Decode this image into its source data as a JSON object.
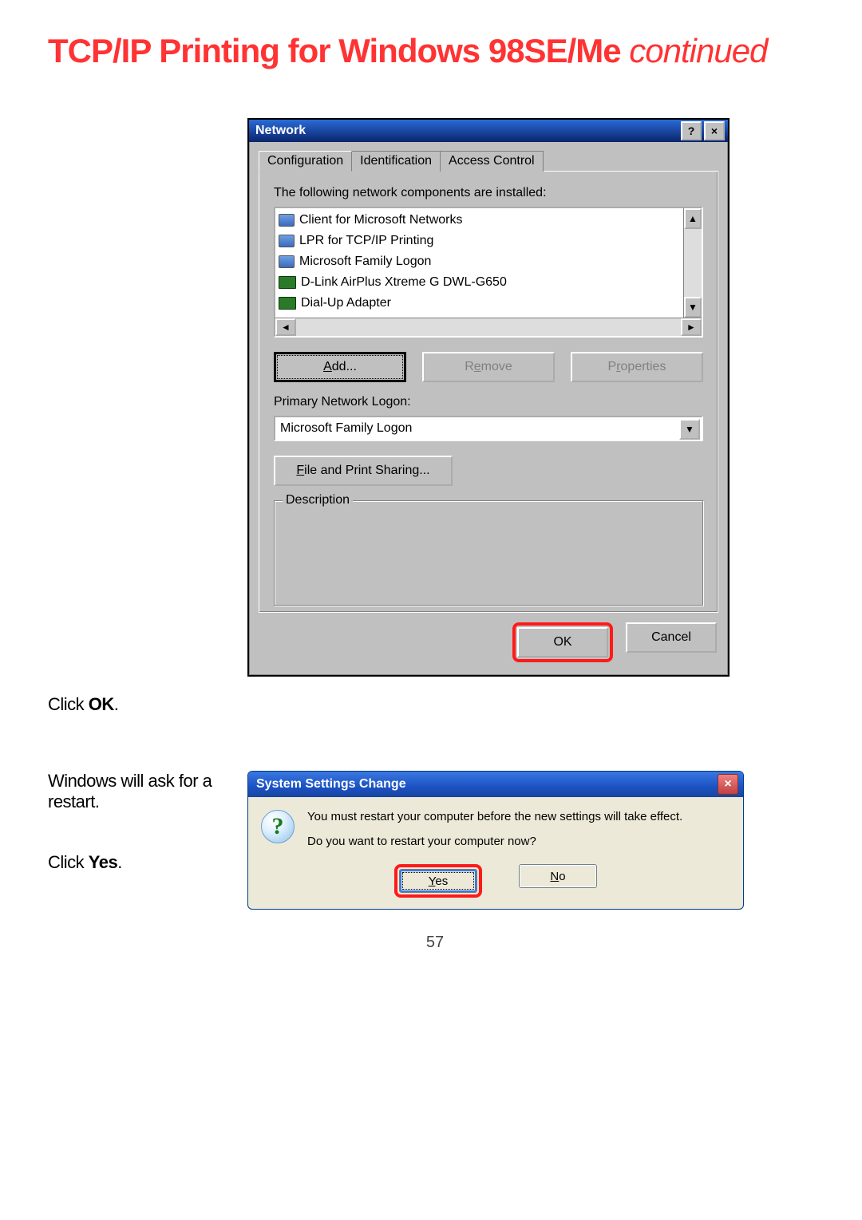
{
  "page": {
    "title_main": "TCP/IP Printing for Windows 98SE/Me ",
    "title_cont": "continued",
    "number": "57"
  },
  "instr1": {
    "pre": "Click ",
    "bold": "OK",
    "post": "."
  },
  "instr2": {
    "line1": "Windows will ask for a restart."
  },
  "instr3": {
    "pre": "Click ",
    "bold": "Yes",
    "post": "."
  },
  "net": {
    "title": "Network",
    "tabs": [
      "Configuration",
      "Identification",
      "Access Control"
    ],
    "label_installed": "The following network components are installed:",
    "items": [
      "Client for Microsoft Networks",
      "LPR for TCP/IP Printing",
      "Microsoft Family Logon",
      "D-Link AirPlus Xtreme G DWL-G650",
      "Dial-Up Adapter"
    ],
    "btn_add": "Add...",
    "btn_remove": "Remove",
    "btn_props": "Properties",
    "label_logon": "Primary Network Logon:",
    "dropdown_value": "Microsoft Family Logon",
    "btn_fileshare": "File and Print Sharing...",
    "group_desc": "Description",
    "btn_ok": "OK",
    "btn_cancel": "Cancel"
  },
  "sys": {
    "title": "System Settings Change",
    "msg1": "You must restart your computer before the new settings will take effect.",
    "msg2": "Do you want to restart your computer now?",
    "btn_yes": "Yes",
    "btn_no": "No"
  }
}
